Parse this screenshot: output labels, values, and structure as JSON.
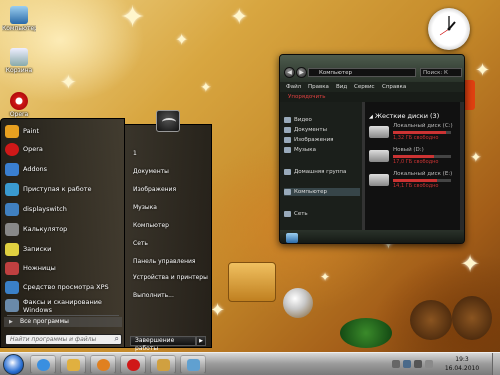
{
  "desktop": {
    "icons": [
      {
        "label": "Компьютер",
        "icon": "computer-icon",
        "color": "#5aa0e0"
      },
      {
        "label": "Корзина",
        "icon": "recycle-bin-icon",
        "color": "#bcd"
      },
      {
        "label": "Opera",
        "icon": "opera-icon",
        "color": "#d01818"
      }
    ]
  },
  "explorer": {
    "address": "Компьютер",
    "search_placeholder": "Поиск: К",
    "menu": [
      "Файл",
      "Правка",
      "Вид",
      "Сервис",
      "Справка"
    ],
    "organize": "Упорядочить",
    "nav_items": [
      {
        "label": "Видео"
      },
      {
        "label": "Документы"
      },
      {
        "label": "Изображения"
      },
      {
        "label": "Музыка"
      },
      {
        "label": "Домашняя группа"
      },
      {
        "label": "Компьютер"
      },
      {
        "label": "Сеть"
      }
    ],
    "section_title": "Жесткие диски (3)",
    "drives": [
      {
        "name": "Локальный диск (C:)",
        "free": "1,32 ГБ свободно",
        "used_fraction": 0.92
      },
      {
        "name": "Новый (D:)",
        "free": "17,0 ГБ свободно",
        "used_fraction": 0.7
      },
      {
        "name": "Локальный диск (E:)",
        "free": "14,1 ГБ свободно",
        "used_fraction": 0.75
      }
    ]
  },
  "start_menu": {
    "programs": [
      {
        "label": "Paint",
        "icon": "paint-icon",
        "color": "#e8a020"
      },
      {
        "label": "Opera",
        "icon": "opera-icon",
        "color": "#d01818"
      },
      {
        "label": "Addons",
        "icon": "addons-icon",
        "color": "#3a7fd0"
      },
      {
        "label": "Приступая к работе",
        "icon": "getting-started-icon",
        "color": "#3a9ad0"
      },
      {
        "label": "displayswitch",
        "icon": "display-switch-icon",
        "color": "#4080c0"
      },
      {
        "label": "Калькулятор",
        "icon": "calculator-icon",
        "color": "#888888"
      },
      {
        "label": "Записки",
        "icon": "sticky-notes-icon",
        "color": "#e0d040"
      },
      {
        "label": "Ножницы",
        "icon": "snipping-tool-icon",
        "color": "#c04040"
      },
      {
        "label": "Средство просмотра XPS",
        "icon": "xps-viewer-icon",
        "color": "#3a80c8"
      },
      {
        "label_line1": "Факсы и сканирование",
        "label_line2": "Windows",
        "icon": "fax-scan-icon",
        "color": "#6a8aaa"
      }
    ],
    "all_programs": "Все программы",
    "search_placeholder": "Найти программы и файлы",
    "right_items": [
      "1",
      "Документы",
      "Изображения",
      "Музыка",
      "Компьютер",
      "Сеть",
      "Панель управления",
      "Устройства и принтеры",
      "Выполнить..."
    ],
    "shutdown": "Завершение работы"
  },
  "taskbar": {
    "time": "19:3",
    "date": "16.04.2010",
    "pinned": [
      {
        "icon": "ie-icon",
        "color": "#3a8fe0"
      },
      {
        "icon": "explorer-icon",
        "color": "#e0b040"
      },
      {
        "icon": "media-player-icon",
        "color": "#e08020"
      },
      {
        "icon": "opera-icon",
        "color": "#d01818"
      },
      {
        "icon": "folder-icon",
        "color": "#d0a040"
      },
      {
        "icon": "paint-icon",
        "color": "#60a0d0"
      }
    ]
  }
}
